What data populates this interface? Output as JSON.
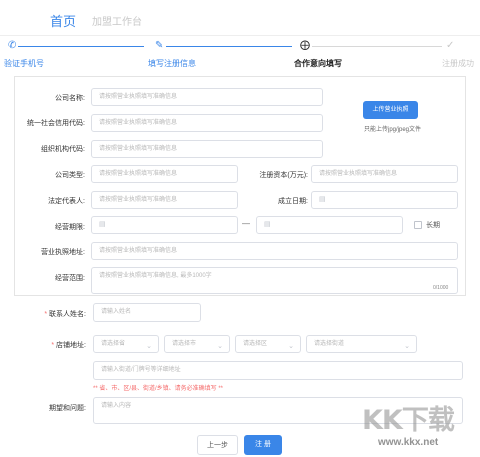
{
  "nav": {
    "home": "首页",
    "workbench": "加盟工作台"
  },
  "steps": [
    {
      "label": "验证手机号",
      "icon": "phone-icon"
    },
    {
      "label": "填写注册信息",
      "icon": "pen-icon"
    },
    {
      "label": "合作意向填写",
      "icon": "target-icon"
    },
    {
      "label": "注册成功",
      "icon": "check-icon"
    }
  ],
  "form": {
    "company_name_label": "公司名称:",
    "credit_code_label": "统一社会信用代码:",
    "org_code_label": "组织机构代码:",
    "company_type_label": "公司类型:",
    "capital_label": "注册资本(万元):",
    "legal_rep_label": "法定代表人:",
    "founded_label": "成立日期:",
    "term_label": "经营期限:",
    "long_term_label": "长期",
    "address_label": "营业执照地址:",
    "scope_label": "经营范围:",
    "placeholder": "请按照营业执照填写准确信息",
    "scope_placeholder": "请按照营业执照填写准确信息, 最多1000字",
    "scope_counter": "0/1000",
    "dash": "—",
    "upload_button": "上传营业执照",
    "upload_note": "只能上传jpg/jpeg文件",
    "contact_label": "联系人姓名:",
    "contact_placeholder": "请输入姓名",
    "store_address_label": "店铺地址:",
    "province_placeholder": "请选择省",
    "city_placeholder": "请选择市",
    "district_placeholder": "请选择区",
    "street_placeholder": "请选择街道",
    "detail_placeholder": "请输入街道/门牌号等详细地址",
    "address_warning": "** 省、市、区/县、街道/乡镇、请务必准确填写 **",
    "expectation_label": "期望和问题:",
    "expectation_placeholder": "请输入内容",
    "asterisk": "*"
  },
  "buttons": {
    "prev": "上一步",
    "register": "注 册"
  },
  "watermark": {
    "logo": "KK下载",
    "url": "www.kkx.net"
  },
  "colors": {
    "accent": "#3a86e8",
    "warning": "#f56c6c"
  }
}
